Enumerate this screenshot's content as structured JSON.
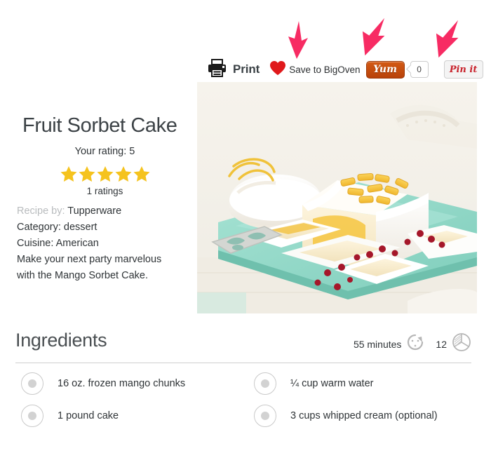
{
  "share_bar": {
    "printer_icon": "printer-icon",
    "print_label": "Print",
    "heart_icon": "heart-icon",
    "bigoven_label": "Save to BigOven",
    "yum_label": "Yum",
    "yum_count": "0",
    "pinit_label": "Pin it"
  },
  "annotations": {
    "arrow_color": "#F72B63",
    "arrows": [
      {
        "name": "arrow-to-save-to-bigoven"
      },
      {
        "name": "arrow-to-yum-button"
      },
      {
        "name": "arrow-to-pin-it-button"
      }
    ]
  },
  "recipe": {
    "title": "Fruit Sorbet Cake",
    "your_rating": "Your rating: 5",
    "stars_filled": 5,
    "star_color": "#F5C31E",
    "ratings_count": "1 ratings",
    "recipe_by_label": "Recipe by:",
    "recipe_by_value": "Tupperware",
    "category_line": "Category: dessert",
    "cuisine_line": "Cuisine: American",
    "description_line_1": "Make your next party marvelous",
    "description_line_2": "with the Mango Sorbet Cake."
  },
  "photo": {
    "alt_name": "fruit-sorbet-cake-photo"
  },
  "ingredients_section": {
    "heading": "Ingredients",
    "time_value": "55 minutes",
    "timer_icon": "timer-icon",
    "servings_value": "12",
    "servings_icon": "servings-pie-icon",
    "items": [
      {
        "text": "16 oz. frozen mango chunks"
      },
      {
        "text": "¼ cup warm water"
      },
      {
        "text": "1 pound cake"
      },
      {
        "text": "3 cups whipped cream (optional)"
      }
    ]
  }
}
